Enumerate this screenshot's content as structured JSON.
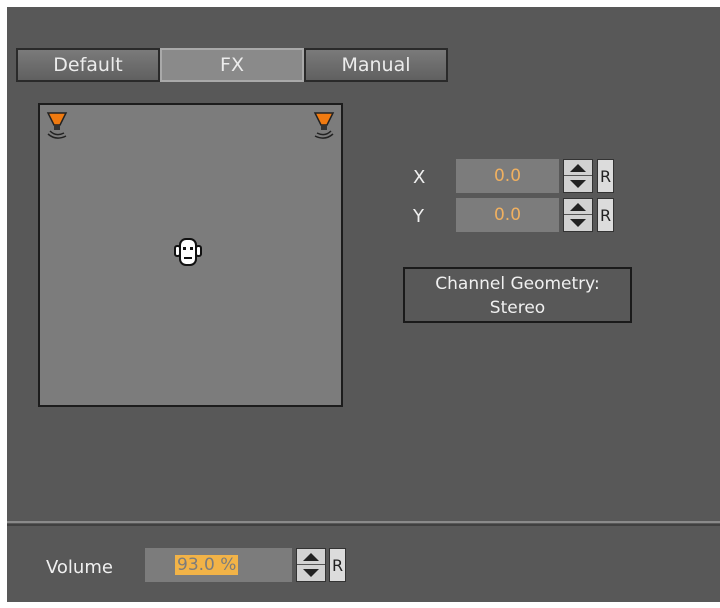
{
  "tabs": [
    {
      "label": "Default",
      "active": false
    },
    {
      "label": "FX",
      "active": true
    },
    {
      "label": "Manual",
      "active": false
    }
  ],
  "speakers": {
    "left_icon": "speaker-icon",
    "right_icon": "speaker-icon",
    "listener_icon": "listener-head-icon"
  },
  "position": {
    "x_label": "X",
    "x_value": "0.0",
    "y_label": "Y",
    "y_value": "0.0",
    "reset_label": "R"
  },
  "channel_geometry": {
    "line1": "Channel Geometry:",
    "line2": "Stereo"
  },
  "volume": {
    "label": "Volume",
    "value": "93.0 %",
    "value_highlight": "93.0 %",
    "reset_label": "R"
  },
  "colors": {
    "value_text": "#f0b060",
    "highlight": "#f2b347",
    "panel": "#585858",
    "speaker": "#f07a10"
  }
}
